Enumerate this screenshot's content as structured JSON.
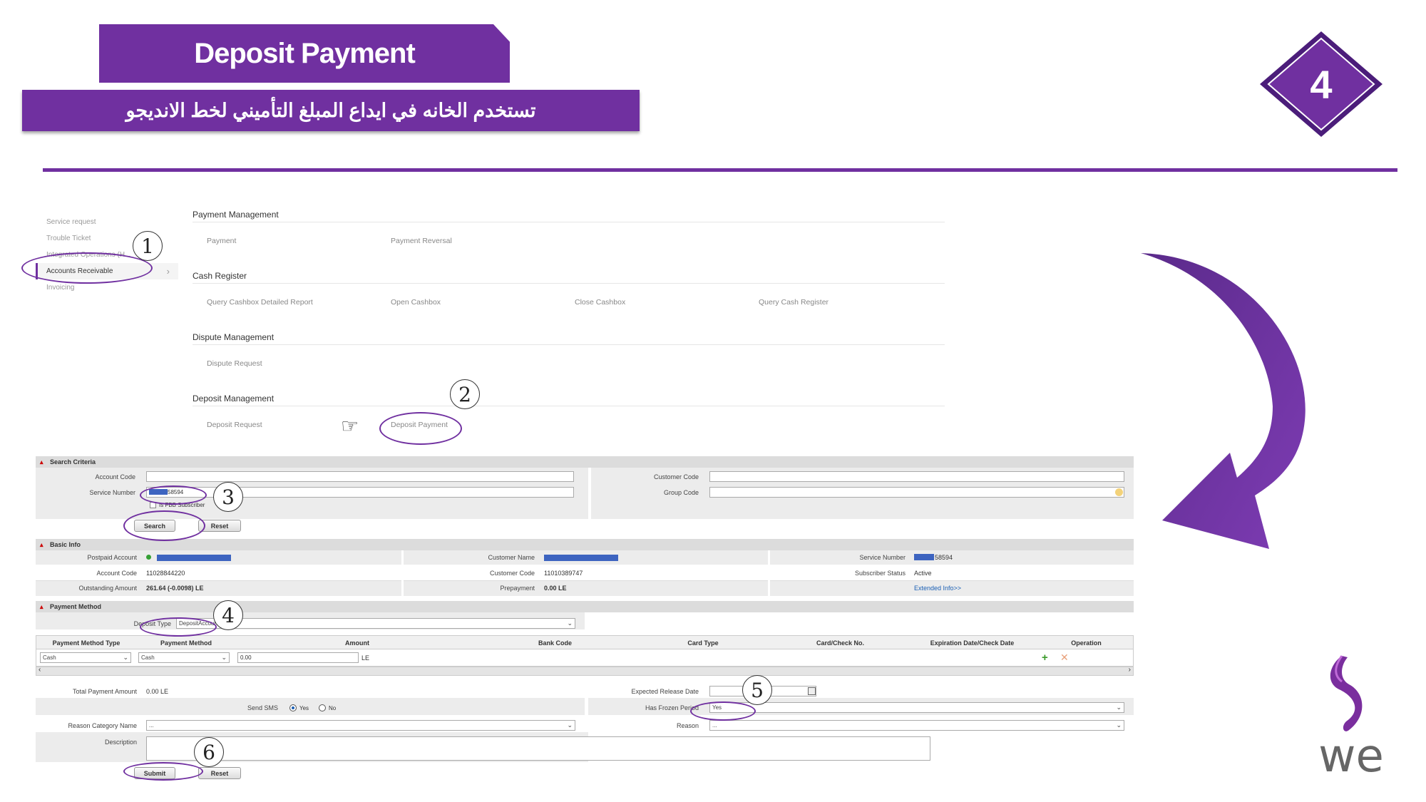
{
  "header": {
    "title": "Deposit Payment",
    "subtitle": "تستخدم الخانه في ايداع المبلغ التأميني لخط الانديجو",
    "step_number": "4"
  },
  "sidebar": {
    "items": [
      {
        "label": "Service request"
      },
      {
        "label": "Trouble Ticket"
      },
      {
        "label": "Integrated Operations (H..."
      },
      {
        "label": "Accounts Receivable"
      },
      {
        "label": "Invoicing"
      }
    ]
  },
  "menu": {
    "payment_management": {
      "title": "Payment Management",
      "links": [
        "Payment",
        "Payment Reversal"
      ]
    },
    "cash_register": {
      "title": "Cash Register",
      "links": [
        "Query Cashbox Detailed Report",
        "Open Cashbox",
        "Close Cashbox",
        "Query Cash Register"
      ]
    },
    "dispute_management": {
      "title": "Dispute Management",
      "links": [
        "Dispute Request"
      ]
    },
    "deposit_management": {
      "title": "Deposit Management",
      "links": [
        "Deposit Request",
        "Deposit Payment"
      ]
    }
  },
  "callouts": [
    "1",
    "2",
    "3",
    "4",
    "5",
    "6"
  ],
  "search_criteria": {
    "header": "Search Criteria",
    "account_code_label": "Account Code",
    "service_number_label": "Service Number",
    "service_number_value": "58594",
    "fbb_label": "Is FBB Subscriber",
    "customer_code_label": "Customer Code",
    "group_code_label": "Group Code",
    "search_button": "Search",
    "reset_button": "Reset"
  },
  "basic_info": {
    "header": "Basic Info",
    "postpaid_account_label": "Postpaid Account",
    "account_code_label": "Account Code",
    "account_code_value": "11028844220",
    "outstanding_amount_label": "Outstanding Amount",
    "outstanding_amount_value": "261.64 (-0.0098) LE",
    "customer_name_label": "Customer Name",
    "customer_code_label": "Customer Code",
    "customer_code_value": "11010389747",
    "prepayment_label": "Prepayment",
    "prepayment_value": "0.00 LE",
    "service_number_label": "Service Number",
    "service_number_value": "58594",
    "subscriber_status_label": "Subscriber Status",
    "subscriber_status_value": "Active",
    "extended_info_link": "Extended Info>>"
  },
  "payment_method": {
    "header": "Payment Method",
    "deposit_type_label": "Deposit Type",
    "deposit_type_value": "DepositAccount",
    "columns": [
      "Payment Method Type",
      "Payment Method",
      "Amount",
      "Bank Code",
      "Card Type",
      "Card/Check No.",
      "Expiration Date/Check Date",
      "Operation"
    ],
    "row": {
      "method_type": "Cash",
      "method": "Cash",
      "amount": "0.00",
      "currency": "LE"
    },
    "total_payment_label": "Total Payment Amount",
    "total_payment_value": "0.00 LE",
    "send_sms_label": "Send SMS",
    "sms_yes": "Yes",
    "sms_no": "No",
    "reason_category_label": "Reason Category Name",
    "reason_category_value": "...",
    "description_label": "Description",
    "expected_release_label": "Expected Release Date",
    "frozen_period_label": "Has Frozen Period",
    "frozen_period_value": "Yes",
    "reason_label": "Reason",
    "reason_value": "...",
    "submit_button": "Submit",
    "reset_button": "Reset"
  },
  "colors": {
    "brand_purple": "#7030a0",
    "section_grey": "#dcdcdc",
    "mask_blue": "#3d64c0"
  },
  "logo_text": "we"
}
